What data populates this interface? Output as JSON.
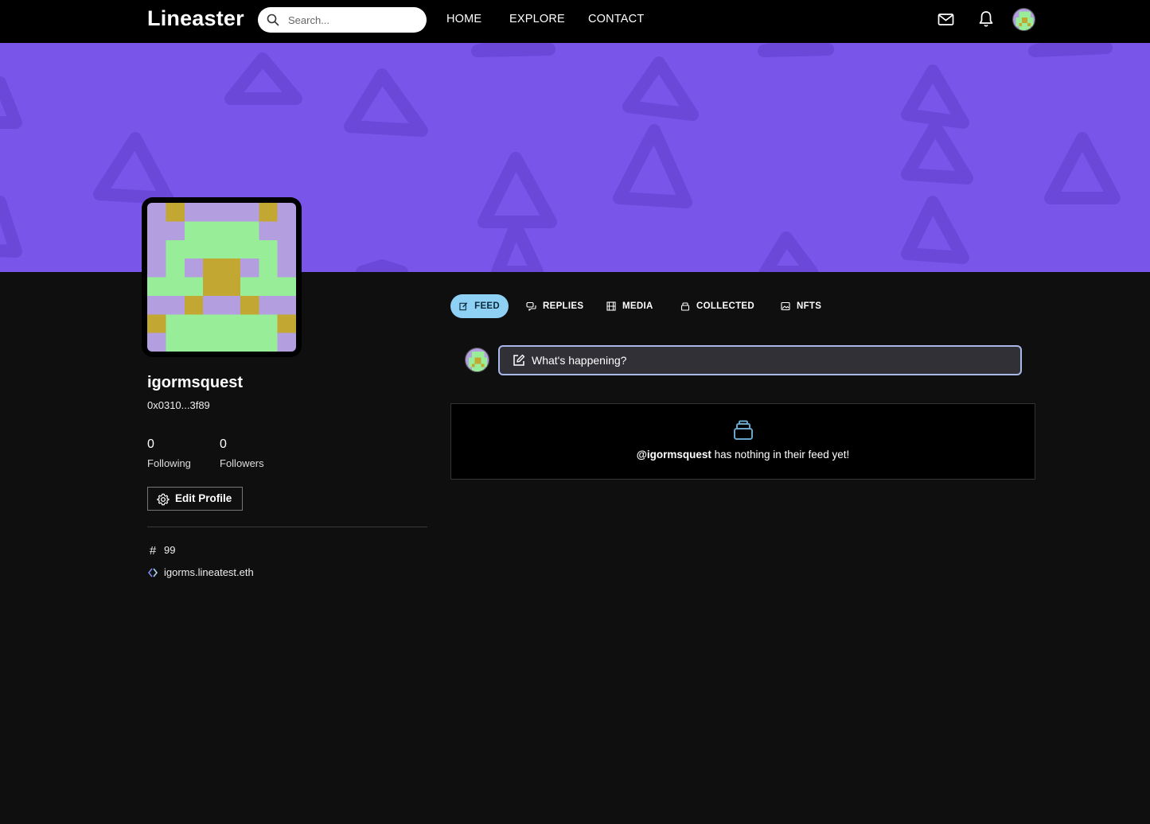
{
  "nav": {
    "logo": "Lineaster",
    "search_placeholder": "Search...",
    "links": [
      "HOME",
      "EXPLORE",
      "CONTACT"
    ],
    "icons": [
      "mail-icon",
      "bell-icon"
    ]
  },
  "profile": {
    "username": "igormsquest",
    "address": "0x0310...3f89",
    "following_count": "0",
    "following_label": "Following",
    "followers_count": "0",
    "followers_label": "Followers",
    "edit_label": "Edit Profile",
    "id_number": "99",
    "ens": "igorms.lineatest.eth"
  },
  "tabs": [
    {
      "label": "FEED",
      "icon": "edit-icon",
      "active": true
    },
    {
      "label": "REPLIES",
      "icon": "chat-icon",
      "active": false
    },
    {
      "label": "MEDIA",
      "icon": "film-icon",
      "active": false
    },
    {
      "label": "COLLECTED",
      "icon": "collection-icon",
      "active": false
    },
    {
      "label": "NFTS",
      "icon": "image-icon",
      "active": false
    }
  ],
  "composer": {
    "placeholder": "What's happening?"
  },
  "empty_feed": {
    "handle": "@igormsquest",
    "message": " has nothing in their feed yet!"
  },
  "colors": {
    "banner": "#7a55ea",
    "active_tab": "#8fd0f5",
    "avatar_green": "#98ee98",
    "avatar_purple": "#b39ee0",
    "avatar_gold": "#c2a832"
  }
}
